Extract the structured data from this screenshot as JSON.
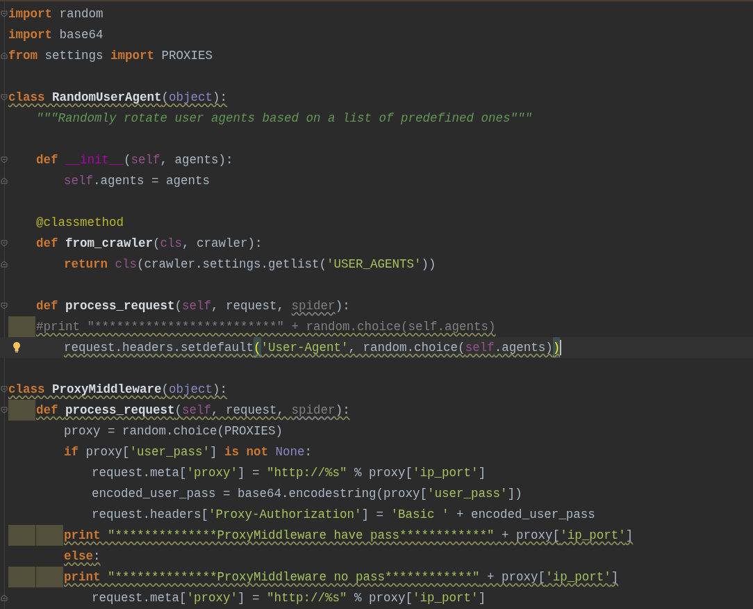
{
  "editor": {
    "lines": [
      {
        "fold_start": true,
        "tokens": [
          {
            "kind": "keyword",
            "text": "import"
          },
          {
            "kind": "text",
            "text": " random"
          }
        ]
      },
      {
        "tokens": [
          {
            "kind": "keyword",
            "text": "import"
          },
          {
            "kind": "text",
            "text": " base64"
          }
        ]
      },
      {
        "fold_end": true,
        "tokens": [
          {
            "kind": "keyword",
            "text": "from"
          },
          {
            "kind": "text",
            "text": " settings "
          },
          {
            "kind": "keyword",
            "text": "import"
          },
          {
            "kind": "text",
            "text": " PROXIES"
          }
        ]
      },
      {
        "blank_before": true,
        "fold_start": true,
        "warning": true,
        "tokens": [
          {
            "kind": "keyword",
            "text": "class "
          },
          {
            "kind": "name",
            "text": "RandomUserAgent"
          },
          {
            "kind": "text",
            "text": "("
          },
          {
            "kind": "builtin",
            "text": "object"
          },
          {
            "kind": "text",
            "text": "):"
          }
        ]
      },
      {
        "indent": [
          {
            "warning": false
          }
        ],
        "tokens": [
          {
            "kind": "docstring",
            "text": "\"\"\"Randomly rotate user agents based on a list of predefined ones\"\"\""
          }
        ]
      },
      {
        "blank_before": true,
        "fold_start": true,
        "indent": [
          {
            "warning": false
          }
        ],
        "tokens": [
          {
            "kind": "keyword",
            "text": "def "
          },
          {
            "kind": "magic",
            "text": "__init__"
          },
          {
            "kind": "text",
            "text": "("
          },
          {
            "kind": "self",
            "text": "self"
          },
          {
            "kind": "text",
            "text": ", agents):"
          }
        ]
      },
      {
        "fold_end": true,
        "indent": [
          {
            "warning": false
          },
          {
            "warning": false
          }
        ],
        "tokens": [
          {
            "kind": "self",
            "text": "self"
          },
          {
            "kind": "text",
            "text": ".agents = agents"
          }
        ]
      },
      {
        "blank_before": true,
        "indent": [
          {
            "warning": false
          }
        ],
        "tokens": [
          {
            "kind": "decorator",
            "text": "@classmethod"
          }
        ]
      },
      {
        "fold_start": true,
        "indent": [
          {
            "warning": false
          }
        ],
        "tokens": [
          {
            "kind": "keyword",
            "text": "def "
          },
          {
            "kind": "name",
            "text": "from_crawler"
          },
          {
            "kind": "text",
            "text": "("
          },
          {
            "kind": "self",
            "text": "cls"
          },
          {
            "kind": "text",
            "text": ", crawler):"
          }
        ]
      },
      {
        "fold_end": true,
        "indent": [
          {
            "warning": false
          },
          {
            "warning": false
          }
        ],
        "tokens": [
          {
            "kind": "keyword",
            "text": "return "
          },
          {
            "kind": "self",
            "text": "cls"
          },
          {
            "kind": "text",
            "text": "(crawler.settings.getlist("
          },
          {
            "kind": "string",
            "text": "'USER_AGENTS'"
          },
          {
            "kind": "text",
            "text": "))"
          }
        ]
      },
      {
        "blank_before": true,
        "fold_start": true,
        "indent": [
          {
            "warning": false
          }
        ],
        "tokens": [
          {
            "kind": "keyword",
            "text": "def "
          },
          {
            "kind": "name",
            "text": "process_request"
          },
          {
            "kind": "text",
            "text": "("
          },
          {
            "kind": "self",
            "text": "self"
          },
          {
            "kind": "text",
            "text": ", request, "
          },
          {
            "kind": "unused",
            "text": "spider",
            "warning": true
          },
          {
            "kind": "text",
            "text": "):"
          }
        ]
      },
      {
        "warning": true,
        "indent": [
          {
            "warning": true
          }
        ],
        "tokens": [
          {
            "kind": "comment",
            "text": "#print \"*************************\" + random.choice(self.agents)"
          }
        ]
      },
      {
        "current": true,
        "warning": true,
        "indent": [
          {
            "warning": false
          },
          {
            "warning": false
          }
        ],
        "tokens": [
          {
            "kind": "text",
            "text": "request.headers.setdefault"
          },
          {
            "kind": "brace",
            "text": "("
          },
          {
            "kind": "string",
            "text": "'User-Agent'"
          },
          {
            "kind": "text",
            "text": ", random.choice("
          },
          {
            "kind": "self",
            "text": "self"
          },
          {
            "kind": "text",
            "text": ".agents)"
          },
          {
            "kind": "brace",
            "text": ")"
          }
        ]
      },
      {
        "blank_before": true,
        "fold_start": true,
        "warning": true,
        "tokens": [
          {
            "kind": "keyword",
            "text": "class "
          },
          {
            "kind": "name",
            "text": "ProxyMiddleware"
          },
          {
            "kind": "text",
            "text": "("
          },
          {
            "kind": "builtin",
            "text": "object"
          },
          {
            "kind": "text",
            "text": "):"
          }
        ]
      },
      {
        "fold_start": true,
        "warning": true,
        "indent": [
          {
            "warning": true
          }
        ],
        "tokens": [
          {
            "kind": "keyword",
            "text": "def "
          },
          {
            "kind": "name",
            "text": "process_request"
          },
          {
            "kind": "text",
            "text": "("
          },
          {
            "kind": "self",
            "text": "self"
          },
          {
            "kind": "text",
            "text": ", request, "
          },
          {
            "kind": "unused",
            "text": "spider",
            "warning": true
          },
          {
            "kind": "text",
            "text": "):"
          }
        ]
      },
      {
        "indent": [
          {
            "warning": false
          },
          {
            "warning": false
          }
        ],
        "tokens": [
          {
            "kind": "text",
            "text": "proxy = random.choice(PROXIES)"
          }
        ]
      },
      {
        "indent": [
          {
            "warning": false
          },
          {
            "warning": false
          }
        ],
        "tokens": [
          {
            "kind": "keyword",
            "text": "if"
          },
          {
            "kind": "text",
            "text": " proxy["
          },
          {
            "kind": "string",
            "text": "'user_pass'"
          },
          {
            "kind": "text",
            "text": "] "
          },
          {
            "kind": "keyword",
            "text": "is not"
          },
          {
            "kind": "constant",
            "text": " None"
          },
          {
            "kind": "text",
            "text": ":"
          }
        ]
      },
      {
        "indent": [
          {
            "warning": false
          },
          {
            "warning": false
          },
          {
            "warning": false
          }
        ],
        "tokens": [
          {
            "kind": "text",
            "text": "request.meta["
          },
          {
            "kind": "string",
            "text": "'proxy'"
          },
          {
            "kind": "text",
            "text": "] = "
          },
          {
            "kind": "string",
            "text": "\"http://%s\""
          },
          {
            "kind": "text",
            "text": " % proxy["
          },
          {
            "kind": "string",
            "text": "'ip_port'"
          },
          {
            "kind": "text",
            "text": "]"
          }
        ]
      },
      {
        "indent": [
          {
            "warning": false
          },
          {
            "warning": false
          },
          {
            "warning": false
          }
        ],
        "tokens": [
          {
            "kind": "text",
            "text": "encoded_user_pass = base64.encodestring(proxy["
          },
          {
            "kind": "string",
            "text": "'user_pass'"
          },
          {
            "kind": "text",
            "text": "])"
          }
        ]
      },
      {
        "indent": [
          {
            "warning": false
          },
          {
            "warning": false
          },
          {
            "warning": false
          }
        ],
        "tokens": [
          {
            "kind": "text",
            "text": "request.headers["
          },
          {
            "kind": "string",
            "text": "'Proxy-Authorization'"
          },
          {
            "kind": "text",
            "text": "] = "
          },
          {
            "kind": "string",
            "text": "'Basic '"
          },
          {
            "kind": "text",
            "text": " + encoded_user_pass"
          }
        ]
      },
      {
        "warning": true,
        "indent": [
          {
            "warning": true
          },
          {
            "warning": true
          }
        ],
        "tokens": [
          {
            "kind": "keyword",
            "text": "print "
          },
          {
            "kind": "string",
            "text": "\"**************ProxyMiddleware have pass************\""
          },
          {
            "kind": "text",
            "text": " + proxy["
          },
          {
            "kind": "string",
            "text": "'ip_port'"
          },
          {
            "kind": "text",
            "text": "]"
          }
        ]
      },
      {
        "warning": true,
        "indent": [
          {
            "warning": false
          },
          {
            "warning": false
          }
        ],
        "tokens": [
          {
            "kind": "keyword",
            "text": "else"
          },
          {
            "kind": "text",
            "text": ":"
          }
        ]
      },
      {
        "warning": true,
        "indent": [
          {
            "warning": true
          },
          {
            "warning": true
          }
        ],
        "tokens": [
          {
            "kind": "keyword",
            "text": "print "
          },
          {
            "kind": "string",
            "text": "\"**************ProxyMiddleware no pass************\""
          },
          {
            "kind": "text",
            "text": " + proxy["
          },
          {
            "kind": "string",
            "text": "'ip_port'"
          },
          {
            "kind": "text",
            "text": "]"
          }
        ]
      },
      {
        "fold_end": true,
        "indent": [
          {
            "warning": false
          },
          {
            "warning": false
          },
          {
            "warning": false
          }
        ],
        "tokens": [
          {
            "kind": "text",
            "text": "request.meta["
          },
          {
            "kind": "string",
            "text": "'proxy'"
          },
          {
            "kind": "text",
            "text": "] = "
          },
          {
            "kind": "string",
            "text": "\"http://%s\""
          },
          {
            "kind": "text",
            "text": " % proxy["
          },
          {
            "kind": "string",
            "text": "'ip_port'"
          },
          {
            "kind": "text",
            "text": "]"
          }
        ]
      }
    ]
  }
}
